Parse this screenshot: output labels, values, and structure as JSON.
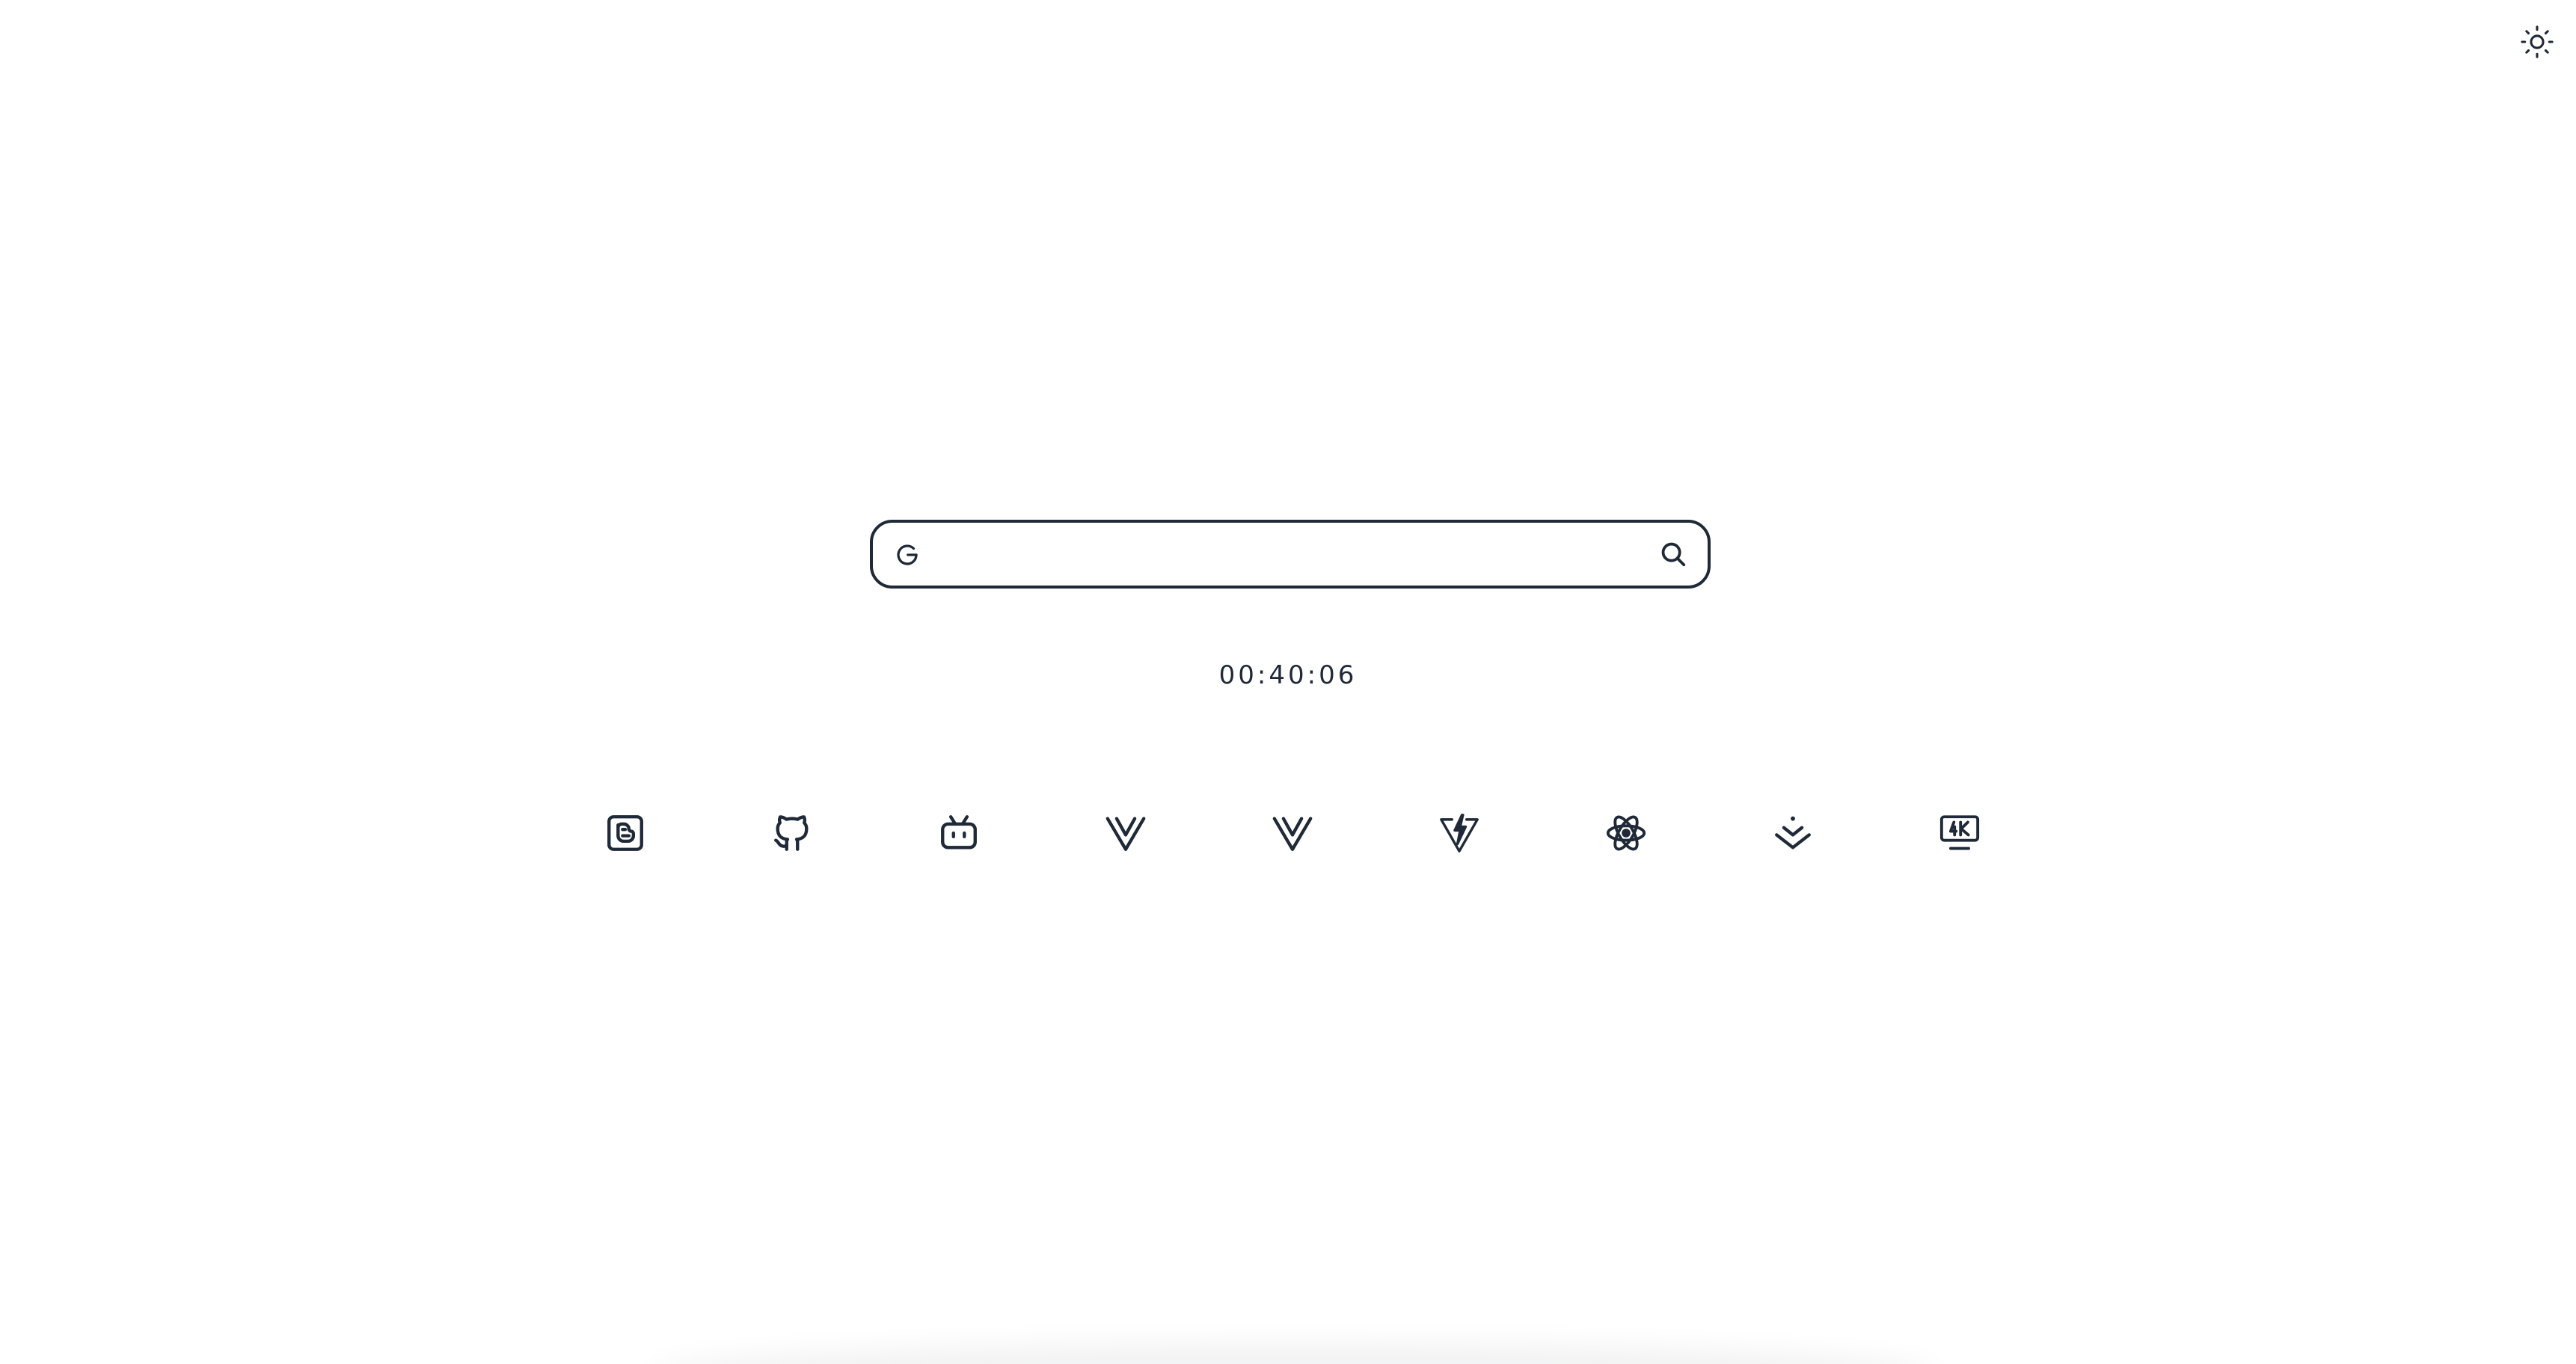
{
  "colors": {
    "background": "#ffffff",
    "foreground": "#1f2937"
  },
  "header": {
    "theme_toggle_icon": "sun-icon"
  },
  "search": {
    "engine_icon": "google-icon",
    "value": "",
    "placeholder": "",
    "submit_icon": "search-icon"
  },
  "clock": {
    "time": "00:40:06"
  },
  "shortcuts": [
    {
      "icon": "blogger-icon"
    },
    {
      "icon": "github-icon"
    },
    {
      "icon": "bilibili-icon"
    },
    {
      "icon": "vue-icon"
    },
    {
      "icon": "vue-icon"
    },
    {
      "icon": "vite-icon"
    },
    {
      "icon": "react-icon"
    },
    {
      "icon": "download-icon"
    },
    {
      "icon": "4k-monitor-icon"
    }
  ]
}
